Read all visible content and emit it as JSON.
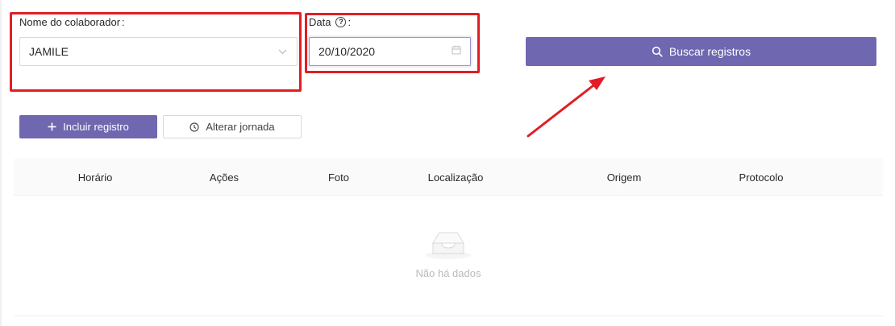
{
  "filters": {
    "employee_label": "Nome do colaborador",
    "employee_value": "JAMILE",
    "date_label": "Data",
    "date_value": "20/10/2020",
    "colon": ":"
  },
  "actions": {
    "search_label": "Buscar registros",
    "add_label": "Incluir registro",
    "shift_label": "Alterar jornada"
  },
  "table": {
    "columns": [
      "Horário",
      "Ações",
      "Foto",
      "Localização",
      "Origem",
      "Protocolo"
    ],
    "empty_text": "Não há dados"
  },
  "colors": {
    "primary": "#6f67b0",
    "highlight": "#e01e25",
    "border": "#d9d9d9"
  },
  "icons": [
    "chevron-down-icon",
    "calendar-icon",
    "help-icon",
    "search-icon",
    "plus-icon",
    "clock-icon",
    "inbox-empty-icon",
    "annotation-arrow"
  ]
}
